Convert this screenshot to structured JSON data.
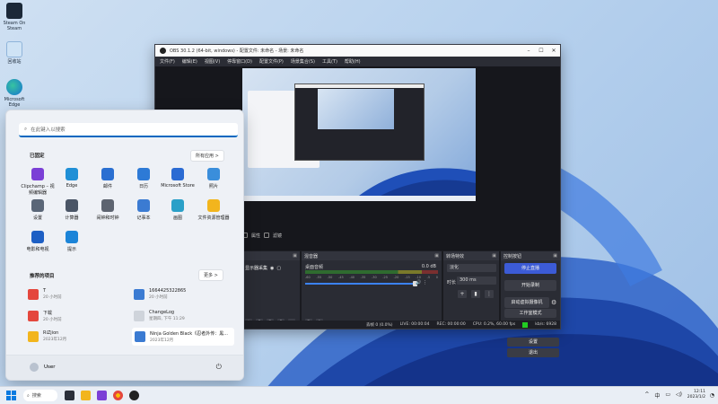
{
  "desktop": {
    "icons": [
      {
        "label": "Steam On Steam"
      },
      {
        "label": "回收站"
      },
      {
        "label": "Microsoft Edge"
      }
    ]
  },
  "obs": {
    "title": "OBS 30.1.2 (64-bit, windows) - 配置文件: 未命名 - 场景: 未命名",
    "menu": [
      "文件(F)",
      "编辑(E)",
      "视图(V)",
      "停靠窗口(D)",
      "配置文件(P)",
      "场景集合(S)",
      "工具(T)",
      "帮助(H)"
    ],
    "preview_toolbar": {
      "properties": "属性",
      "filters": "滤镜"
    },
    "sources": {
      "title": "",
      "item": "显示器采集"
    },
    "mixer": {
      "title": "混音器",
      "channel": "桌面音频",
      "db": "0.0 dB",
      "scale": [
        "-60",
        "-55",
        "-50",
        "-45",
        "-40",
        "-35",
        "-30",
        "-25",
        "-20",
        "-15",
        "-10",
        "-5",
        "0"
      ],
      "volume_fraction": 0.82
    },
    "transitions": {
      "title": "转场特效",
      "type": "淡化",
      "duration_label": "时长",
      "duration": "300 ms"
    },
    "controls": {
      "title": "控制按钮",
      "buttons": [
        {
          "label": "停止直播",
          "active": true
        },
        {
          "label": "开始录制",
          "active": false
        },
        {
          "label": "启动虚拟摄像机",
          "active": false
        },
        {
          "label": "工作室模式",
          "active": false
        },
        {
          "label": "设置",
          "active": false
        },
        {
          "label": "退出",
          "active": false
        }
      ]
    },
    "status": {
      "dropped": "丢帧 0 (0.0%)",
      "live": "LIVE: 00:00:04",
      "rec": "REC: 00:00:00",
      "cpu": "CPU: 0.2%, 60.00 fps",
      "kbps": "kb/s: 6928"
    }
  },
  "start_menu": {
    "search_placeholder": "在此键入以搜索",
    "pinned_title": "已固定",
    "all_apps": "所有应用  >",
    "pinned": [
      {
        "label": "Clipchamp – 视频编辑器",
        "color": "#7b3fd6"
      },
      {
        "label": "Edge",
        "color": "#1f8fd6"
      },
      {
        "label": "邮件",
        "color": "#2a6fd1"
      },
      {
        "label": "日历",
        "color": "#2d7ad6"
      },
      {
        "label": "Microsoft Store",
        "color": "#2b6bd3"
      },
      {
        "label": "照片",
        "color": "#3a8edb"
      },
      {
        "label": "设置",
        "color": "#5a6677"
      },
      {
        "label": "计算器",
        "color": "#4a5566"
      },
      {
        "label": "闹钟和时钟",
        "color": "#5d6470"
      },
      {
        "label": "记事本",
        "color": "#3b7bd2"
      },
      {
        "label": "画图",
        "color": "#2aa0c8"
      },
      {
        "label": "文件资源管理器",
        "color": "#f2b51d"
      },
      {
        "label": "电影和电视",
        "color": "#1d5fc4"
      },
      {
        "label": "提示",
        "color": "#1b84d8"
      }
    ],
    "recommended_title": "推荐的项目",
    "more": "更多  >",
    "recommended": [
      {
        "name": "T",
        "sub": "20 小时前",
        "color": "#e4473d"
      },
      {
        "name": "下载",
        "sub": "20 小时前",
        "color": "#e4473d"
      },
      {
        "name": "RiZjion",
        "sub": "2023年12月",
        "color": "#f2b51d"
      },
      {
        "name": "1664425322865",
        "sub": "20 小时前",
        "color": "#3b7bd2"
      },
      {
        "name": "ChangeLog",
        "sub": "星期四, 下午 11:29",
        "color": "#cfd4db"
      },
      {
        "name": "Ninja Golden Black《忍者外传：黑...",
        "sub": "2023年12月",
        "color": "#3b7bd2"
      }
    ],
    "user": "User"
  },
  "taskbar": {
    "search": "搜索",
    "tray_lang": "中",
    "clock_time": "12:11",
    "clock_date": "2023/1/2"
  }
}
